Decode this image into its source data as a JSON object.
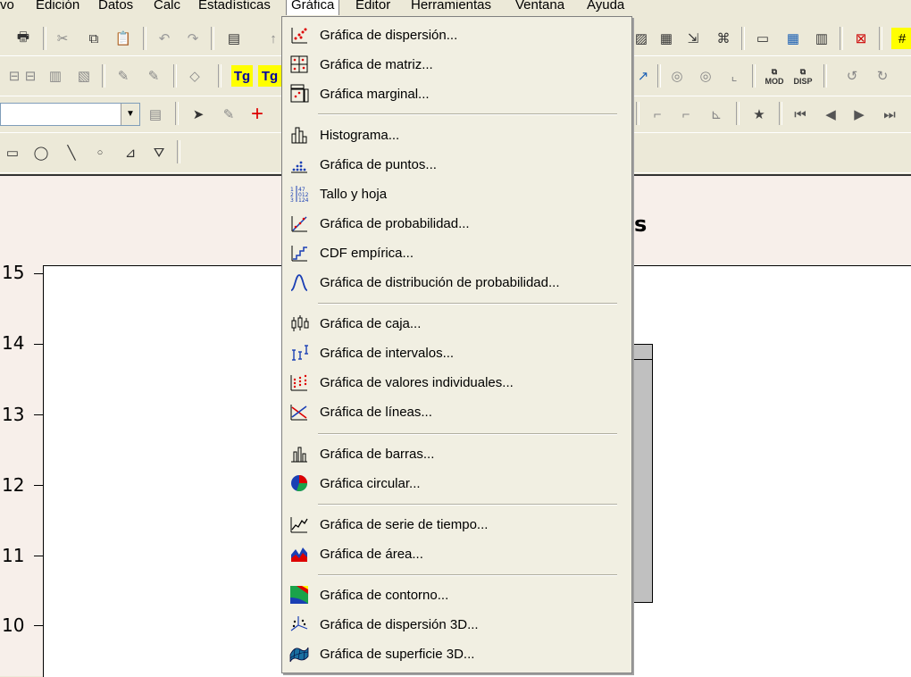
{
  "menubar": {
    "items": [
      "vo",
      "Edición",
      "Datos",
      "Calc",
      "Estadísticas",
      "Gráfica",
      "Editor",
      "Herramientas",
      "Ventana",
      "Ayuda"
    ]
  },
  "toolbar": {
    "tg1": "Tg",
    "tg2": "Tg",
    "mod": "MOD",
    "disp": "DISP"
  },
  "graph": {
    "title_fragment": "s",
    "y_ticks": [
      "15",
      "14",
      "13",
      "12",
      "11",
      "10"
    ]
  },
  "menu": {
    "items": [
      "Gráfica de dispersión...",
      "Gráfica de matriz...",
      "Gráfica marginal...",
      "Histograma...",
      "Gráfica de puntos...",
      "Tallo y hoja",
      "Gráfica de probabilidad...",
      "CDF empírica...",
      "Gráfica de distribución de probabilidad...",
      "Gráfica de caja...",
      "Gráfica de intervalos...",
      "Gráfica de valores individuales...",
      "Gráfica de líneas...",
      "Gráfica de barras...",
      "Gráfica circular...",
      "Gráfica de serie de tiempo...",
      "Gráfica de área...",
      "Gráfica de contorno...",
      "Gráfica de dispersión 3D...",
      "Gráfica de superficie 3D..."
    ]
  },
  "colors": {
    "menu_bg": "#f1efe2",
    "chrome_bg": "#ece9d8",
    "graph_bg": "#f7efea"
  }
}
